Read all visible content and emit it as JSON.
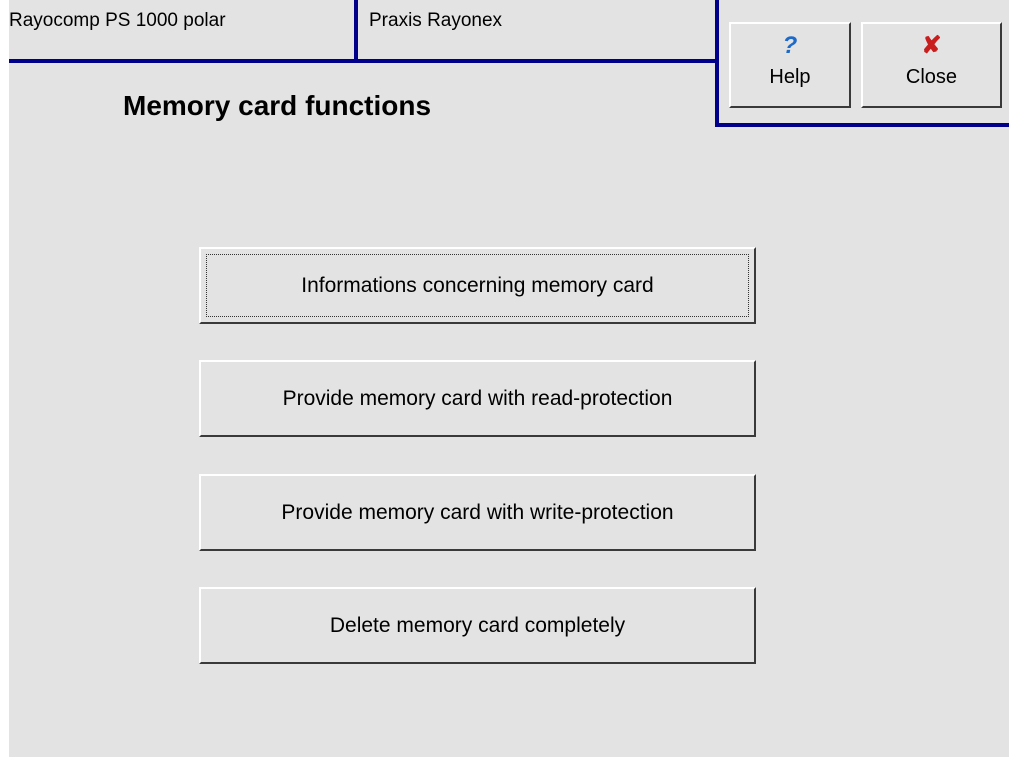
{
  "header": {
    "device_name": "Rayocomp PS 1000 polar",
    "practice_name": "Praxis Rayonex",
    "line_color": "#00008b"
  },
  "page": {
    "title": "Memory card functions"
  },
  "toolbar": {
    "help_label": "Help",
    "help_icon": "?",
    "help_icon_color": "#1e6ac8",
    "close_label": "Close",
    "close_icon": "✘",
    "close_icon_color": "#c81e1e"
  },
  "menu": {
    "items": [
      {
        "label": "Informations concerning memory card",
        "focused": true
      },
      {
        "label": "Provide memory card with read-protection",
        "focused": false
      },
      {
        "label": "Provide memory card with write-protection",
        "focused": false
      },
      {
        "label": "Delete memory card completely",
        "focused": false
      }
    ]
  }
}
